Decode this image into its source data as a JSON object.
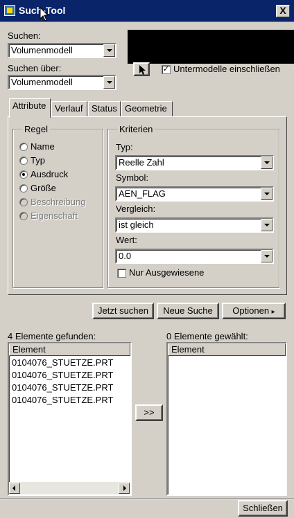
{
  "window": {
    "title": "Such-Tool",
    "close_label": "X"
  },
  "search": {
    "label": "Suchen:",
    "value": "Volumenmodell"
  },
  "search_over": {
    "label": "Suchen über:",
    "value": "Volumenmodell"
  },
  "submodels": {
    "label": "Untermodelle einschließen",
    "checked": true,
    "check_mark": "✓"
  },
  "tabs": [
    {
      "label": "Attribute",
      "active": true
    },
    {
      "label": "Verlauf",
      "active": false
    },
    {
      "label": "Status",
      "active": false
    },
    {
      "label": "Geometrie",
      "active": false
    }
  ],
  "rule": {
    "title": "Regel",
    "options": [
      {
        "label": "Name",
        "selected": false,
        "enabled": true
      },
      {
        "label": "Typ",
        "selected": false,
        "enabled": true
      },
      {
        "label": "Ausdruck",
        "selected": true,
        "enabled": true
      },
      {
        "label": "Größe",
        "selected": false,
        "enabled": true
      },
      {
        "label": "Beschreibung",
        "selected": false,
        "enabled": false
      },
      {
        "label": "Eigenschaft",
        "selected": false,
        "enabled": false
      }
    ]
  },
  "criteria": {
    "title": "Kriterien",
    "type_label": "Typ:",
    "type_value": "Reelle Zahl",
    "symbol_label": "Symbol:",
    "symbol_value": "AEN_FLAG",
    "compare_label": "Vergleich:",
    "compare_value": "ist gleich",
    "value_label": "Wert:",
    "value_value": "0.0",
    "only_shown_label": "Nur Ausgewiesene",
    "only_shown_checked": false
  },
  "actions": {
    "search_now": "Jetzt suchen",
    "new_search": "Neue Suche",
    "options": "Optionen",
    "options_arrow": "▸"
  },
  "found": {
    "label": "4 Elemente gefunden:",
    "column": "Element",
    "items": [
      "0104076_STUETZE.PRT",
      "0104076_STUETZE.PRT",
      "0104076_STUETZE.PRT",
      "0104076_STUETZE.PRT"
    ]
  },
  "transfer_label": ">>",
  "selected": {
    "label": "0 Elemente gewählt:",
    "column": "Element",
    "items": []
  },
  "close_button": "Schließen",
  "colors": {
    "titlebar": "#0a246a",
    "face": "#d4d0c8"
  }
}
